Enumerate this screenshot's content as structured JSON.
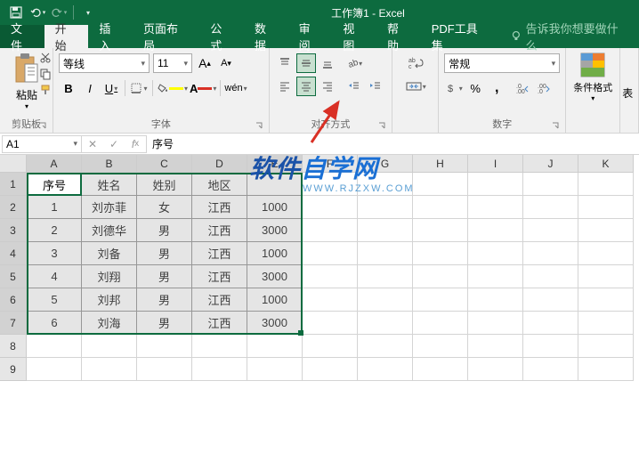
{
  "app": {
    "title": "工作簿1 - Excel"
  },
  "tabs": {
    "file": "文件",
    "home": "开始",
    "insert": "插入",
    "layout": "页面布局",
    "formulas": "公式",
    "data": "数据",
    "review": "审阅",
    "view": "视图",
    "help": "帮助",
    "pdf": "PDF工具集",
    "tell": "告诉我你想要做什么"
  },
  "ribbon": {
    "paste": "粘贴",
    "clipboard": "剪贴板",
    "font": "字体",
    "align": "对齐方式",
    "number": "数字",
    "cf": "条件格式",
    "cells": "表",
    "font_name": "等线",
    "font_size": "11",
    "number_format": "常规"
  },
  "namebox": "A1",
  "fx": "序号",
  "cols": [
    "A",
    "B",
    "C",
    "D",
    "E",
    "F",
    "G",
    "H",
    "I",
    "J",
    "K"
  ],
  "rows": [
    "1",
    "2",
    "3",
    "4",
    "5",
    "6",
    "7",
    "8",
    "9"
  ],
  "table": {
    "headers": [
      "序号",
      "姓名",
      "姓别",
      "地区",
      ""
    ],
    "data": [
      [
        "1",
        "刘亦菲",
        "女",
        "江西",
        "1000"
      ],
      [
        "2",
        "刘德华",
        "男",
        "江西",
        "3000"
      ],
      [
        "3",
        "刘备",
        "男",
        "江西",
        "1000"
      ],
      [
        "4",
        "刘翔",
        "男",
        "江西",
        "3000"
      ],
      [
        "5",
        "刘邦",
        "男",
        "江西",
        "1000"
      ],
      [
        "6",
        "刘海",
        "男",
        "江西",
        "3000"
      ]
    ]
  },
  "watermark": {
    "t1": "软件",
    "t2": "自学网",
    "url": "WWW.RJZXW.COM"
  }
}
